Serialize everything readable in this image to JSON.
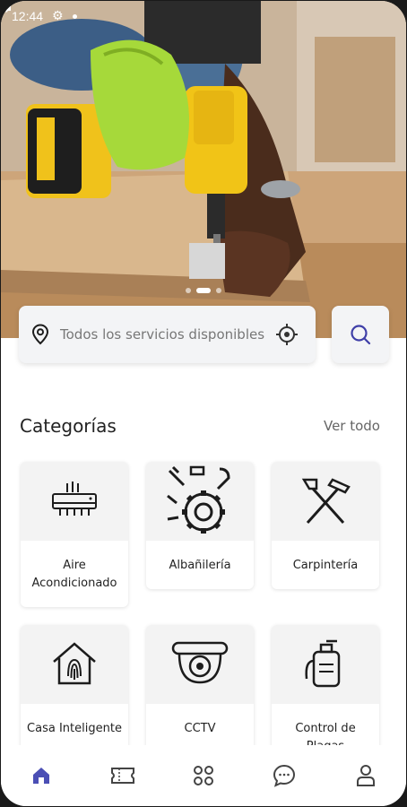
{
  "status_bar": {
    "time": "12:44"
  },
  "search": {
    "placeholder": "Todos los servicios disponibles"
  },
  "categories": {
    "title": "Categorías",
    "see_all": "Ver todo",
    "items": [
      {
        "label": "Aire Acondicionado",
        "icon": "air-conditioner-icon"
      },
      {
        "label": "Albañilería",
        "icon": "tools-gear-icon"
      },
      {
        "label": "Carpintería",
        "icon": "carpentry-tools-icon"
      },
      {
        "label": "Casa Inteligente",
        "icon": "smart-home-fingerprint-icon"
      },
      {
        "label": "CCTV",
        "icon": "cctv-camera-icon"
      },
      {
        "label": "Control de Plagas",
        "icon": "pest-sprayer-icon"
      }
    ]
  },
  "nav": {
    "items": [
      "home-icon",
      "ticket-icon",
      "grid-icon",
      "chat-icon",
      "profile-icon"
    ],
    "active_color": "#4b4fb5"
  },
  "colors": {
    "accent": "#3f3fa8",
    "icon": "#1c1c1c"
  }
}
